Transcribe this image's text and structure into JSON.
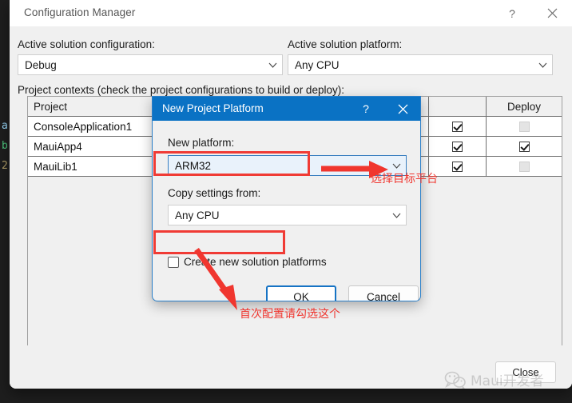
{
  "window": {
    "title": "Configuration Manager",
    "help_icon": "question-mark-icon",
    "close_icon": "close-x-icon",
    "close_button_label": "Close"
  },
  "solution": {
    "config_label": "Active solution configuration:",
    "config_value": "Debug",
    "platform_label": "Active solution platform:",
    "platform_value": "Any CPU"
  },
  "contexts": {
    "section_label": "Project contexts (check the project configurations to build or deploy):",
    "headers": {
      "project": "Project",
      "configuration": "",
      "platform": "",
      "build": "",
      "deploy": "Deploy"
    },
    "rows": [
      {
        "project": "ConsoleApplication1",
        "configuration": "",
        "platform": "",
        "build": "checked",
        "deploy": "disabled"
      },
      {
        "project": "MauiApp4",
        "configuration": "",
        "platform": "",
        "build": "checked",
        "deploy": "checked"
      },
      {
        "project": "MauiLib1",
        "configuration": "",
        "platform": "",
        "build": "checked",
        "deploy": "disabled"
      }
    ]
  },
  "dialog": {
    "title": "New Project Platform",
    "help_icon": "question-mark-icon",
    "close_icon": "close-x-icon",
    "new_platform_label": "New platform:",
    "new_platform_value": "ARM32",
    "copy_settings_label": "Copy settings from:",
    "copy_settings_value": "Any CPU",
    "create_checkbox_label": "Create new solution platforms",
    "create_checkbox_state": "unchecked",
    "ok_label": "OK",
    "cancel_label": "Cancel"
  },
  "annotations": {
    "platform_note": "选择目标平台",
    "checkbox_note": "首次配置请勾选这个",
    "accent_red": "#f0362f",
    "accent_blue": "#0a72c4"
  },
  "watermark": {
    "text": "Maui开发者",
    "icon": "wechat-icon"
  },
  "editor_backdrop": {
    "fragments": [
      "",
      "a",
      "b",
      "2"
    ]
  }
}
